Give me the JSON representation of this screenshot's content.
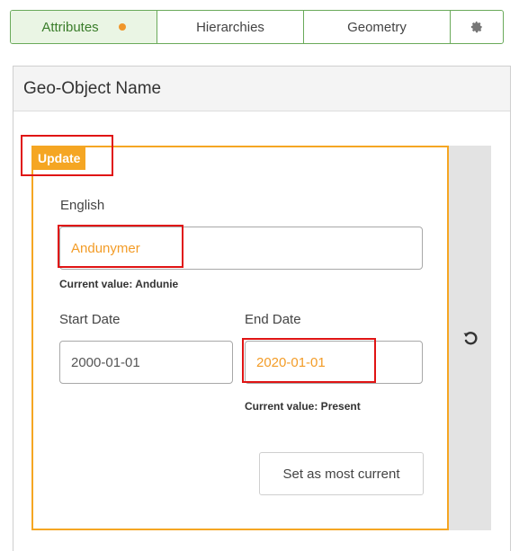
{
  "tabs": [
    {
      "label": "Attributes",
      "active": true,
      "modified_indicator": true
    },
    {
      "label": "Hierarchies",
      "active": false
    },
    {
      "label": "Geometry",
      "active": false
    },
    {
      "icon": "gear-icon"
    }
  ],
  "panel": {
    "title": "Geo-Object Name"
  },
  "card": {
    "badge": "Update",
    "english_label": "English",
    "english_value": "Andunymer",
    "english_current": "Current value: Andunie",
    "start_date_label": "Start Date",
    "start_date_value": "2000-01-01",
    "end_date_label": "End Date",
    "end_date_value": "2020-01-01",
    "end_date_current": "Current value: Present",
    "set_current_button": "Set as most current",
    "revert_icon": "undo-icon"
  },
  "colors": {
    "accent_green": "#6aaa5a",
    "change_orange": "#f5a623",
    "annotation_red": "#e01414"
  }
}
